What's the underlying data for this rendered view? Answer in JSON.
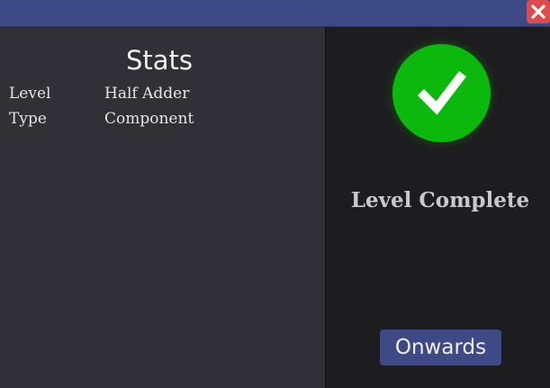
{
  "stats": {
    "title": "Stats",
    "rows": [
      {
        "label": "Level",
        "value": "Half Adder"
      },
      {
        "label": "Type",
        "value": "Component"
      }
    ]
  },
  "result": {
    "message": "Level Complete",
    "status_color": "#0cb80c"
  },
  "actions": {
    "onwards_label": "Onwards"
  },
  "colors": {
    "titlebar": "#3e4a86",
    "close_button": "#e04a4a",
    "left_panel": "#313036",
    "right_panel": "#1d1d1f"
  },
  "icons": {
    "close": "close-icon",
    "status": "checkmark-icon"
  }
}
